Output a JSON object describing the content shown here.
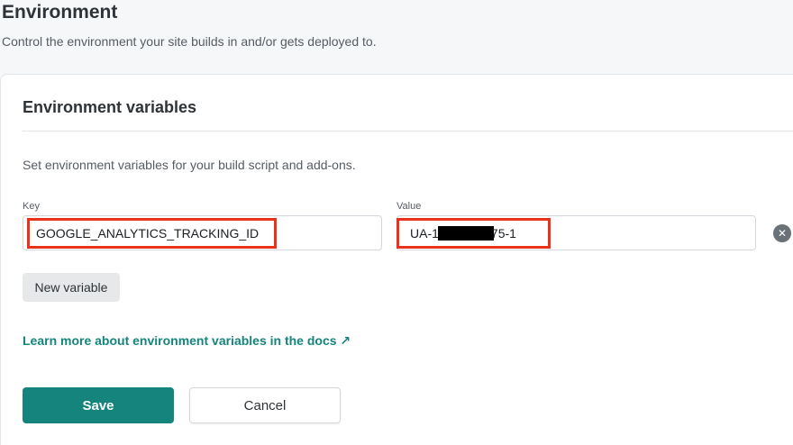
{
  "header": {
    "title": "Environment",
    "description": "Control the environment your site builds in and/or gets deployed to."
  },
  "card": {
    "title": "Environment variables",
    "description": "Set environment variables for your build script and add-ons."
  },
  "variable": {
    "key_label": "Key",
    "value_label": "Value",
    "key": "GOOGLE_ANALYTICS_TRACKING_ID",
    "value_prefix": "UA-1",
    "value_suffix": "75-1",
    "delete_icon": "close-circle-icon"
  },
  "actions": {
    "new_variable_label": "New variable",
    "docs_link_label": "Learn more about environment variables in the docs",
    "docs_link_arrow": "↗",
    "save_label": "Save",
    "cancel_label": "Cancel"
  },
  "colors": {
    "accent": "#15847d",
    "highlight": "#e8321c"
  }
}
